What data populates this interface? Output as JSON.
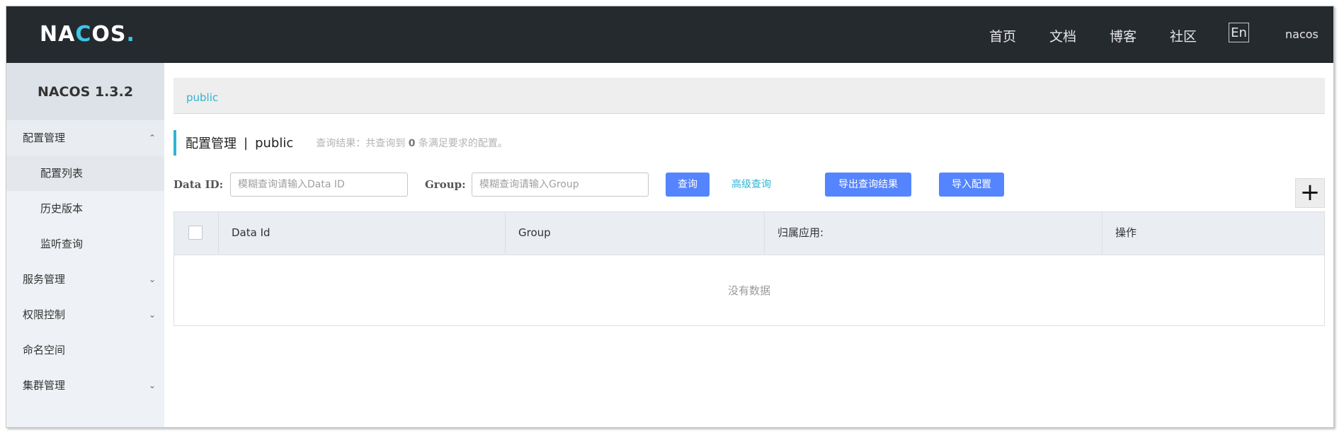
{
  "header": {
    "logo": {
      "pre": "NA",
      "o": "C",
      "post": "OS",
      "dot": "."
    },
    "nav": [
      "首页",
      "文档",
      "博客",
      "社区"
    ],
    "lang": "En",
    "user": "nacos"
  },
  "sidebar": {
    "version": "NACOS 1.3.2",
    "items": [
      {
        "label": "配置管理",
        "chevron": "up-chevron-icon"
      },
      {
        "label": "配置列表"
      },
      {
        "label": "历史版本"
      },
      {
        "label": "监听查询"
      },
      {
        "label": "服务管理",
        "chevron": "down-chevron-icon"
      },
      {
        "label": "权限控制",
        "chevron": "down-chevron-icon"
      },
      {
        "label": "命名空间"
      },
      {
        "label": "集群管理",
        "chevron": "down-chevron-icon"
      }
    ]
  },
  "main": {
    "namespace_link": "public",
    "title": "配置管理",
    "separator": "|",
    "namespace": "public",
    "hint_pre": "查询结果：共查询到",
    "hint_count": "0",
    "hint_post": "条满足要求的配置。",
    "filters": {
      "dataid_label": "Data ID:",
      "dataid_placeholder": "模糊查询请输入Data ID",
      "group_label": "Group:",
      "group_placeholder": "模糊查询请输入Group",
      "query_button": "查询",
      "advanced_query": "高级查询",
      "export_button": "导出查询结果",
      "import_button": "导入配置"
    },
    "add_button": "+",
    "table": {
      "columns": [
        "Data Id",
        "Group",
        "归属应用:",
        "操作"
      ],
      "empty_text": "没有数据"
    }
  },
  "colors": {
    "header_bg": "#252a2f",
    "accent": "#2fb5d2",
    "primary_button": "#5584ff",
    "sidebar_bg": "#eef1f5"
  }
}
